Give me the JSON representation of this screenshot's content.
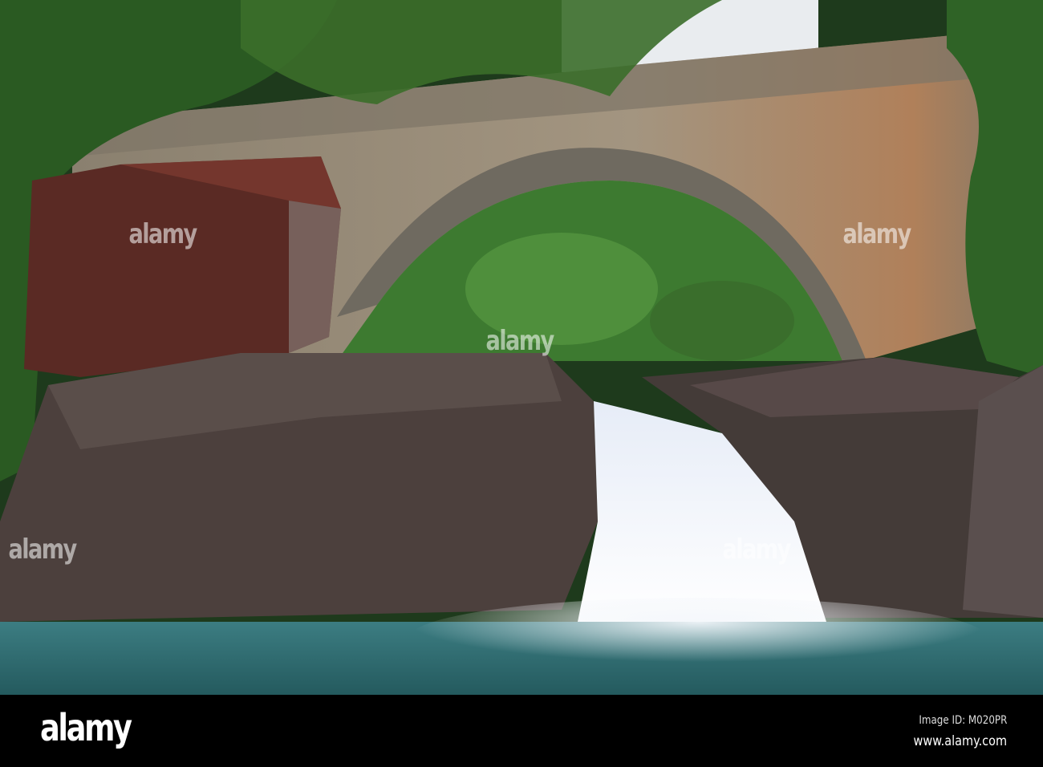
{
  "photo": {
    "subject": "stone arch bridge over waterfall",
    "watermark_text": "alamy",
    "colors": {
      "sky": "#e9ecef",
      "foliage": "#2c5a25",
      "bridge": "#9a8d78",
      "arch_underside": "#6f6a60",
      "red_boulder": "#5a2a24",
      "rock": "#4a3f3c",
      "water": "#2f6b70",
      "falls": "#eef2fa"
    }
  },
  "footer": {
    "logo": "alamy",
    "image_id": "Image ID: M020PR",
    "website": "www.alamy.com"
  }
}
